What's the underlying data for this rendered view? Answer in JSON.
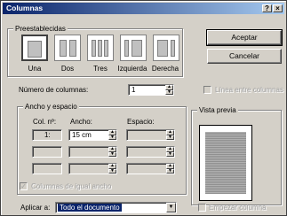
{
  "window": {
    "title": "Columnas",
    "help_button": "?",
    "close_button": "×"
  },
  "presets": {
    "group_title": "Preestablecidas",
    "items": [
      {
        "label": "Una"
      },
      {
        "label": "Dos"
      },
      {
        "label": "Tres"
      },
      {
        "label": "Izquierda"
      },
      {
        "label": "Derecha"
      }
    ],
    "selected": "Una"
  },
  "buttons": {
    "accept": "Aceptar",
    "cancel": "Cancelar"
  },
  "num_columns": {
    "label": "Número de columnas:",
    "value": "1"
  },
  "line_between": {
    "label": "Línea entre columnas",
    "checked": false,
    "enabled": false
  },
  "width_spacing": {
    "group_title": "Ancho y espacio",
    "col_header": "Col. nº:",
    "width_header": "Ancho:",
    "spacing_header": "Espacio:",
    "rows": [
      {
        "col": "1:",
        "width": "15 cm",
        "spacing": ""
      },
      {
        "col": "",
        "width": "",
        "spacing": ""
      },
      {
        "col": "",
        "width": "",
        "spacing": ""
      }
    ],
    "equal_width": {
      "label": "Columnas de igual ancho",
      "checked": true,
      "enabled": false
    }
  },
  "preview": {
    "group_title": "Vista previa"
  },
  "apply_to": {
    "label": "Aplicar a:",
    "value": "Todo el documento"
  },
  "new_column": {
    "label": "Empezar columna",
    "checked": false,
    "enabled": false
  },
  "icons": {
    "help": "help-icon",
    "close": "close-icon",
    "spin": "spin-arrows-icon",
    "dropdown": "chevron-down-icon"
  },
  "colors": {
    "titlebar_start": "#0a246a",
    "titlebar_end": "#a6caf0",
    "dialog_face": "#d4d0c8"
  }
}
